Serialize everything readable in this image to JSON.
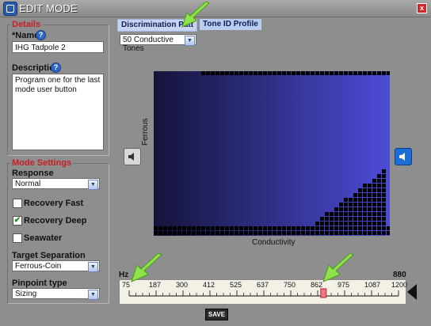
{
  "window": {
    "title": "EDIT MODE",
    "close_label": "x"
  },
  "details": {
    "legend": "Details",
    "name_label": "*Name",
    "name_value": "IHG Tadpole 2",
    "description_label": "Description",
    "description_value": "Program one for the last mode user button"
  },
  "mode_settings": {
    "legend": "Mode Settings",
    "response_label": "Response",
    "response_value": "Normal",
    "recovery_fast_label": "Recovery Fast",
    "recovery_fast_checked": false,
    "recovery_deep_label": "Recovery Deep",
    "recovery_deep_checked": true,
    "seawater_label": "Seawater",
    "seawater_checked": false,
    "target_separation_label": "Target Separation",
    "target_separation_value": "Ferrous-Coin",
    "pinpoint_label": "Pinpoint type",
    "pinpoint_value": "Sizing"
  },
  "tabs": [
    {
      "label": "Discrimination Patt",
      "active": true
    },
    {
      "label": "Tone ID Profile",
      "active": false
    }
  ],
  "tones_select": {
    "value": "50 Conductive Tones"
  },
  "plot": {
    "y_axis_label": "Ferrous",
    "x_axis_label": "Conductivity"
  },
  "frequency_scale": {
    "unit_label": "Hz",
    "max_value_label": "880",
    "ticks": [
      "75",
      "187",
      "300",
      "412",
      "525",
      "637",
      "750",
      "862",
      "975",
      "1087",
      "1200"
    ],
    "marker_fraction": 0.72
  },
  "save_label": "SAVE",
  "colors": {
    "accent_red": "#c81c24",
    "panel_bg": "#8e8e8e",
    "plot_dark": "#101030",
    "plot_light": "#4a4ad0"
  },
  "icons": [
    "app-icon",
    "close-icon",
    "help-icon",
    "speaker-icon",
    "speaker-muted-icon",
    "pointer-arrow-icon"
  ]
}
